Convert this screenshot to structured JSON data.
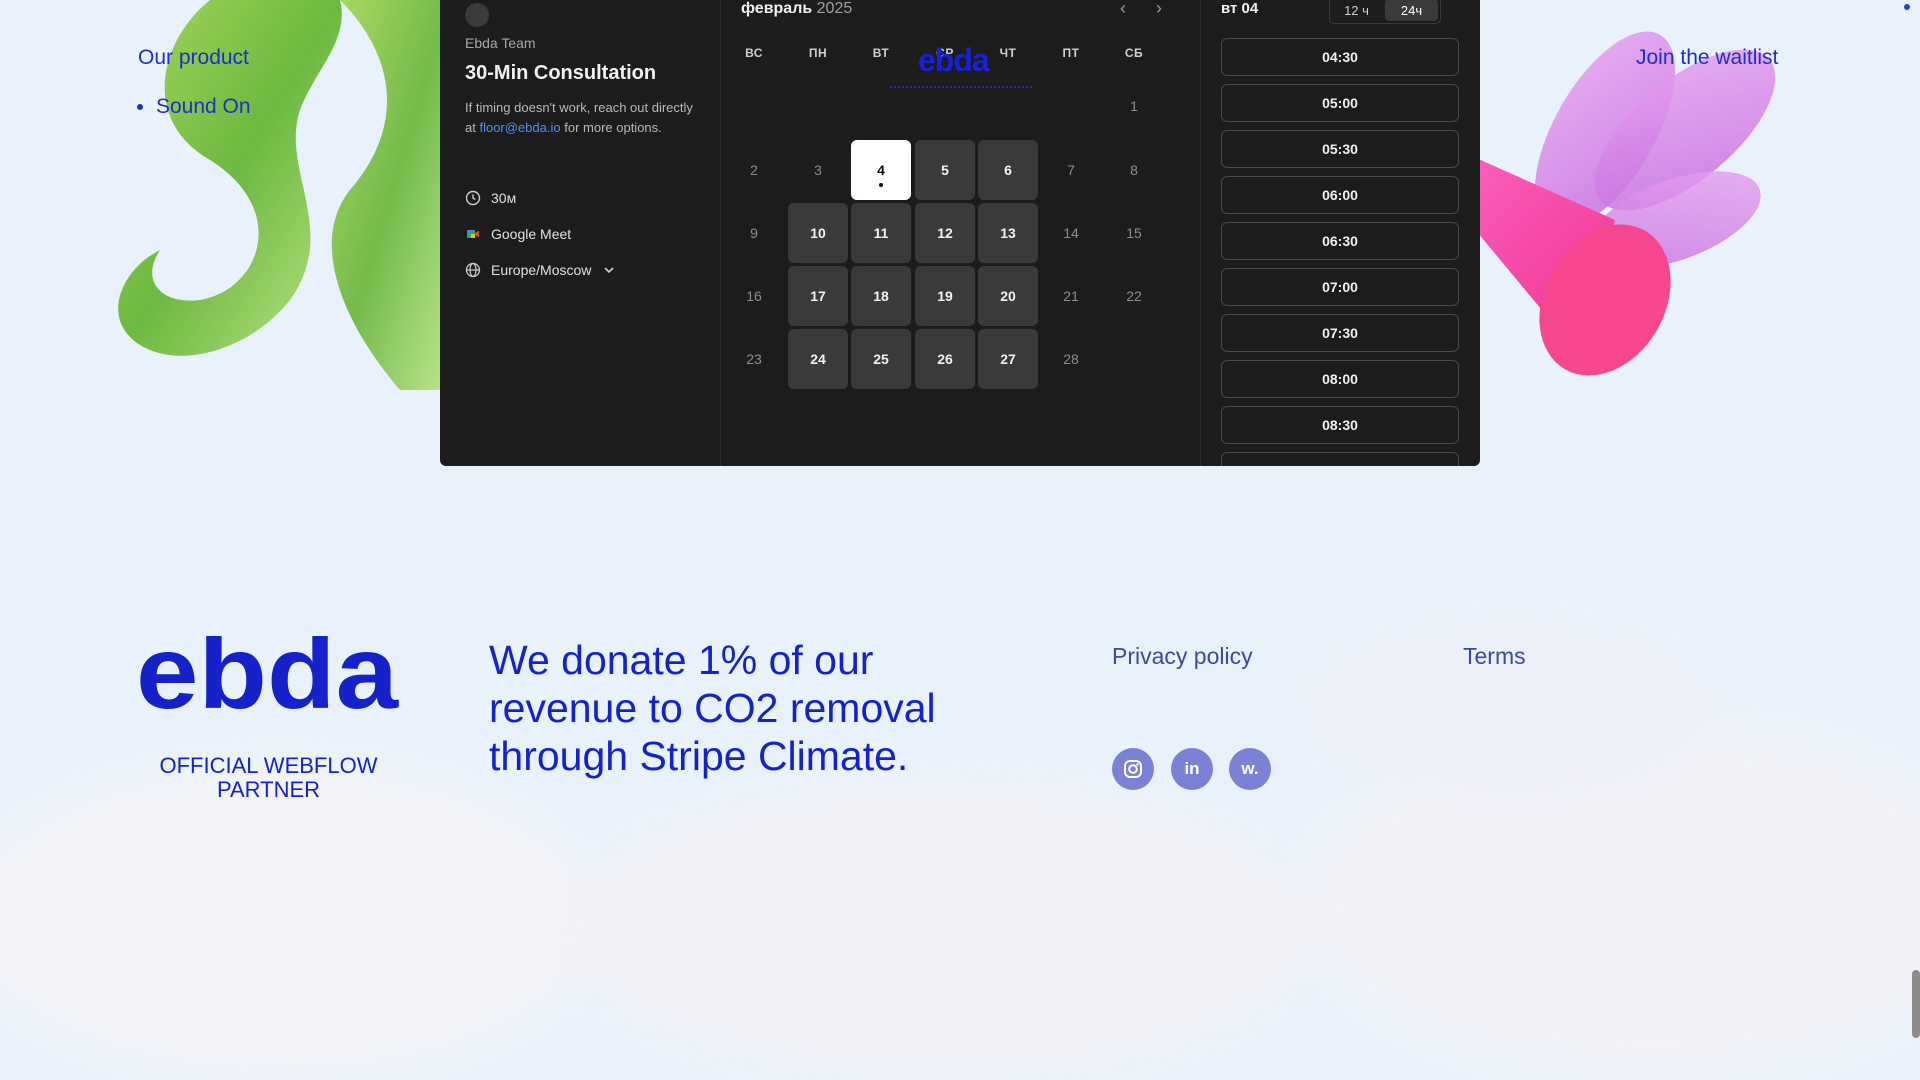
{
  "nav": {
    "our_product": "Our product",
    "sound_on": "Sound On",
    "join_waitlist": "Join the waitlist"
  },
  "booking": {
    "team": "Ebda Team",
    "title": "30-Min Consultation",
    "desc_prefix": "If timing doesn't work, reach out directly at ",
    "email": "floor@ebda.io",
    "desc_suffix": " for more options.",
    "duration": "30м",
    "platform": "Google Meet",
    "timezone": "Europe/Moscow",
    "calendar": {
      "month": "февраль",
      "year": "2025",
      "weekdays": [
        "ВС",
        "ПН",
        "ВТ",
        "СР",
        "ЧТ",
        "ПТ",
        "СБ"
      ],
      "today": 4,
      "available_days": [
        4,
        5,
        6,
        10,
        11,
        12,
        13,
        17,
        18,
        19,
        20,
        24,
        25,
        26,
        27
      ]
    },
    "selected_day": "вт 04",
    "toggle_12": "12 ч",
    "toggle_24": "24ч",
    "slots": [
      "04:30",
      "05:00",
      "05:30",
      "06:00",
      "06:30",
      "07:00",
      "07:30",
      "08:00",
      "08:30",
      ""
    ]
  },
  "overlay_logo": "ebda",
  "footer": {
    "logo": "ebda",
    "partner": "OFFICIAL WEBFLOW PARTNER",
    "donate": "We donate 1% of our revenue to CO2 removal through Stripe Climate.",
    "privacy": "Privacy policy",
    "terms": "Terms",
    "social": {
      "instagram": "",
      "linkedin": "in",
      "webflow": "w."
    }
  },
  "colors": {
    "brand": "#1522c9",
    "widget_bg": "#1c1c1c",
    "page_bg": "#e9f2fb"
  }
}
